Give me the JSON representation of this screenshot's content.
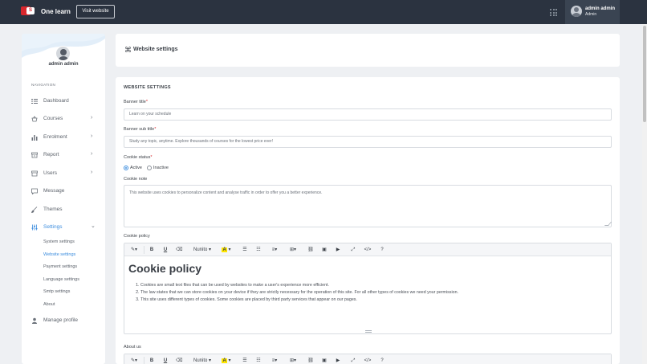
{
  "topbar": {
    "brand": "One learn",
    "logo_letter": "S",
    "visit_button": "Visit website",
    "user_name": "admin admin",
    "user_role": "Admin"
  },
  "sidebar": {
    "username": "admin admin",
    "nav_heading": "NAVIGATION",
    "items": [
      {
        "label": "Dashboard",
        "icon": "dashboard-icon"
      },
      {
        "label": "Courses",
        "icon": "basket-icon"
      },
      {
        "label": "Enrolment",
        "icon": "bar-chart-icon"
      },
      {
        "label": "Report",
        "icon": "report-icon"
      },
      {
        "label": "Users",
        "icon": "users-icon"
      },
      {
        "label": "Message",
        "icon": "message-icon"
      },
      {
        "label": "Themes",
        "icon": "brush-icon"
      },
      {
        "label": "Settings",
        "icon": "sliders-icon"
      },
      {
        "label": "Manage profile",
        "icon": "person-icon"
      }
    ],
    "settings_sub": [
      "System settings",
      "Website settings",
      "Payment settings",
      "Language settings",
      "Smtp settings",
      "About"
    ],
    "active_sub": "Website settings"
  },
  "page": {
    "title": "Website settings",
    "section_heading": "WEBSITE SETTINGS",
    "banner_title_label": "Banner title",
    "banner_title_value": "Learn on your schedule",
    "banner_sub_label": "Banner sub title",
    "banner_sub_value": "Study any topic, anytime. Explore thousands of courses for the lowest price ever!",
    "cookie_status_label": "Cookie status",
    "radio_active": "Active",
    "radio_inactive": "Inactive",
    "cookie_status_value": "Active",
    "cookie_note_label": "Cookie note",
    "cookie_note_value": "This website uses cookies to personalize content and analyse traffic in order to offer you a better experience.",
    "cookie_policy_label": "Cookie policy",
    "about_us_label": "About us",
    "required_mark": "*"
  },
  "editor": {
    "font_name": "Nunito",
    "heading": "Cookie policy",
    "list": [
      "Cookies are small text files that can be used by websites to make a user's experience more efficient.",
      "The law states that we can store cookies on your device if they are strictly necessary for the operation of this site. For all other types of cookies we need your permission.",
      "This site uses different types of cookies. Some cookies are placed by third party services that appear on our pages."
    ]
  },
  "colors": {
    "topbar": "#2b3340",
    "accent": "#3c8dde",
    "danger": "#d9262c",
    "background": "#eef0f3"
  }
}
